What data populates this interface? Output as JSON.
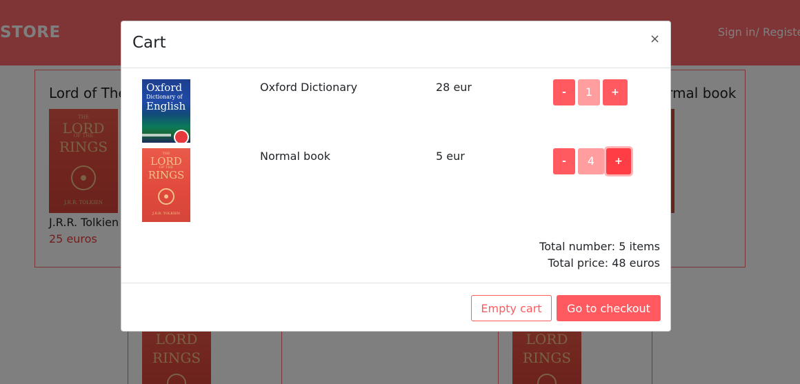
{
  "navbar": {
    "brand": "STORE",
    "auth_link": "Sign in/ Register"
  },
  "background": {
    "cards": [
      {
        "title": "Lord of The Rings",
        "author": "J.R.R. Tolkien",
        "price": "25 euros"
      },
      {
        "title": "Normal book"
      }
    ]
  },
  "covers": {
    "lotr": {
      "line1": "THE",
      "line2": "LORD",
      "line3": "OF THE",
      "line4": "RINGS",
      "author": "J.R.R. TOLKIEN"
    },
    "oxford": {
      "line1": "Oxford",
      "line2": "Dictionary of",
      "line3": "English"
    }
  },
  "cart": {
    "title": "Cart",
    "close_symbol": "×",
    "items": [
      {
        "name": "Oxford Dictionary",
        "price": "28 eur",
        "quantity": "1",
        "minus": "-",
        "plus": "+"
      },
      {
        "name": "Normal book",
        "price": "5 eur",
        "quantity": "4",
        "minus": "-",
        "plus": "+"
      }
    ],
    "total_number": "Total number: 5 items",
    "total_price": "Total price: 48 euros",
    "empty_label": "Empty cart",
    "checkout_label": "Go to checkout"
  },
  "colors": {
    "primary": "#ff5a5f",
    "navbar": "#ff6b6b",
    "qty_bg": "#ff9d9f"
  }
}
